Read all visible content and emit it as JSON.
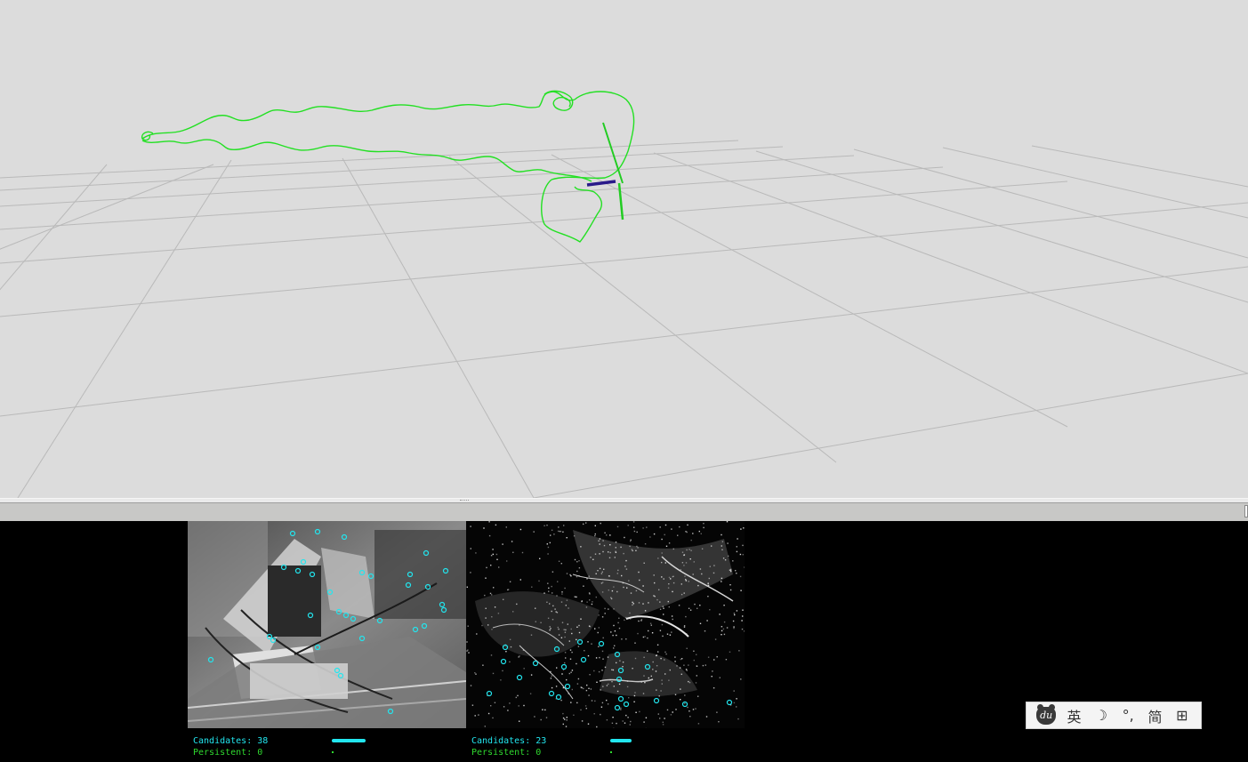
{
  "viewport": {
    "background": "#dcdcdc",
    "trajectory_color": "#22e022",
    "pose_x_axis_color": "#2a1a8a",
    "pose_z_axis_color": "#22cc22"
  },
  "left_image": {
    "candidates_label": "Candidates: 38",
    "persistent_label": "Persistent: 0",
    "feature_color": "#22e6ef"
  },
  "right_image": {
    "candidates_label": "Candidates: 23",
    "persistent_label": "Persistent: 0",
    "feature_color": "#22e6ef"
  },
  "ime_toolbar": {
    "logo_text": "du",
    "language_label": "英",
    "moon_icon": "☽",
    "punctuation_label": "°,",
    "script_label": "简",
    "grid_icon": "⊞"
  }
}
